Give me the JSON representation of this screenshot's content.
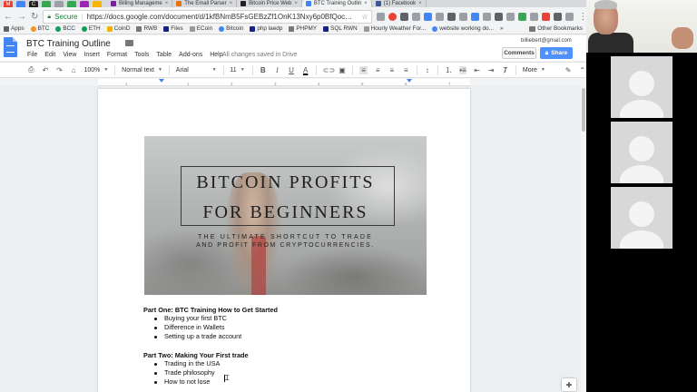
{
  "browser": {
    "tabs": [
      {
        "label": "Billing Manageme",
        "color": "#7b1fa2"
      },
      {
        "label": "The Email Parser",
        "color": "#e8710a"
      },
      {
        "label": "Bitcoin Price Web",
        "color": "#222222"
      },
      {
        "label": "BTC Training Outlin",
        "color": "#4285f4",
        "active": true
      },
      {
        "label": "(1) Facebook",
        "color": "#3b5998"
      }
    ],
    "close_glyph": "×",
    "address": {
      "secure_label": "Secure",
      "url": "https://docs.google.com/document/d/1kfBNmB5FsGEBzZf1OnK13Nxy6p0BfQocQ-IlK..."
    },
    "bookmarks": [
      {
        "label": "Apps",
        "color": "#5f6368"
      },
      {
        "label": "BTC",
        "color": "#f7931a"
      },
      {
        "label": "BCC",
        "color": "#0f9d58"
      },
      {
        "label": "ETH",
        "color": "#0f9d58"
      },
      {
        "label": "CoinD",
        "color": "#f4b400"
      },
      {
        "label": "RWB",
        "color": "#777777"
      },
      {
        "label": "Files",
        "color": "#1a237e"
      },
      {
        "label": "ECoin",
        "color": "#999999"
      },
      {
        "label": "Bitcoin",
        "color": "#4285f4"
      },
      {
        "label": "php laedp",
        "color": "#1a237e"
      },
      {
        "label": "PHPMY",
        "color": "#777777"
      },
      {
        "label": "SQL RWN",
        "color": "#1a237e"
      },
      {
        "label": "Hourly Weather For...",
        "color": "#999999"
      },
      {
        "label": "website working do...",
        "color": "#4285f4"
      }
    ],
    "bookmarks_more": "»",
    "other_bookmarks": "Other Bookmarks"
  },
  "docs": {
    "title": "BTC Training Outline",
    "menu": [
      "File",
      "Edit",
      "View",
      "Insert",
      "Format",
      "Tools",
      "Table",
      "Add-ons",
      "Help"
    ],
    "save_status": "All changes saved in Drive",
    "user_email": "billiebert@gmail.com",
    "comments_label": "Comments",
    "share_label": "Share",
    "toolbar": {
      "zoom": "100%",
      "style": "Normal text",
      "font": "Arial",
      "size": "11",
      "more": "More"
    },
    "ruler_ticks": [
      "1",
      "1",
      "2",
      "3",
      "4",
      "5",
      "6",
      "7"
    ]
  },
  "banner": {
    "title_line1": "BITCOIN PROFITS",
    "title_line2": "FOR BEGINNERS",
    "subtitle_line1": "THE ULTIMATE SHORTCUT TO TRADE",
    "subtitle_line2": "AND PROFIT FROM CRYPTOCURRENCIES."
  },
  "document": {
    "part1": {
      "heading": "Part One: BTC Training How to Get Started",
      "items": [
        "Buying your first BTC",
        "Difference in Wallets",
        "Setting up a trade account"
      ]
    },
    "part2": {
      "heading": "Part Two: Making Your First trade",
      "items": [
        "Trading in the USA",
        "Trade philosophy",
        "How to not lose"
      ]
    }
  }
}
